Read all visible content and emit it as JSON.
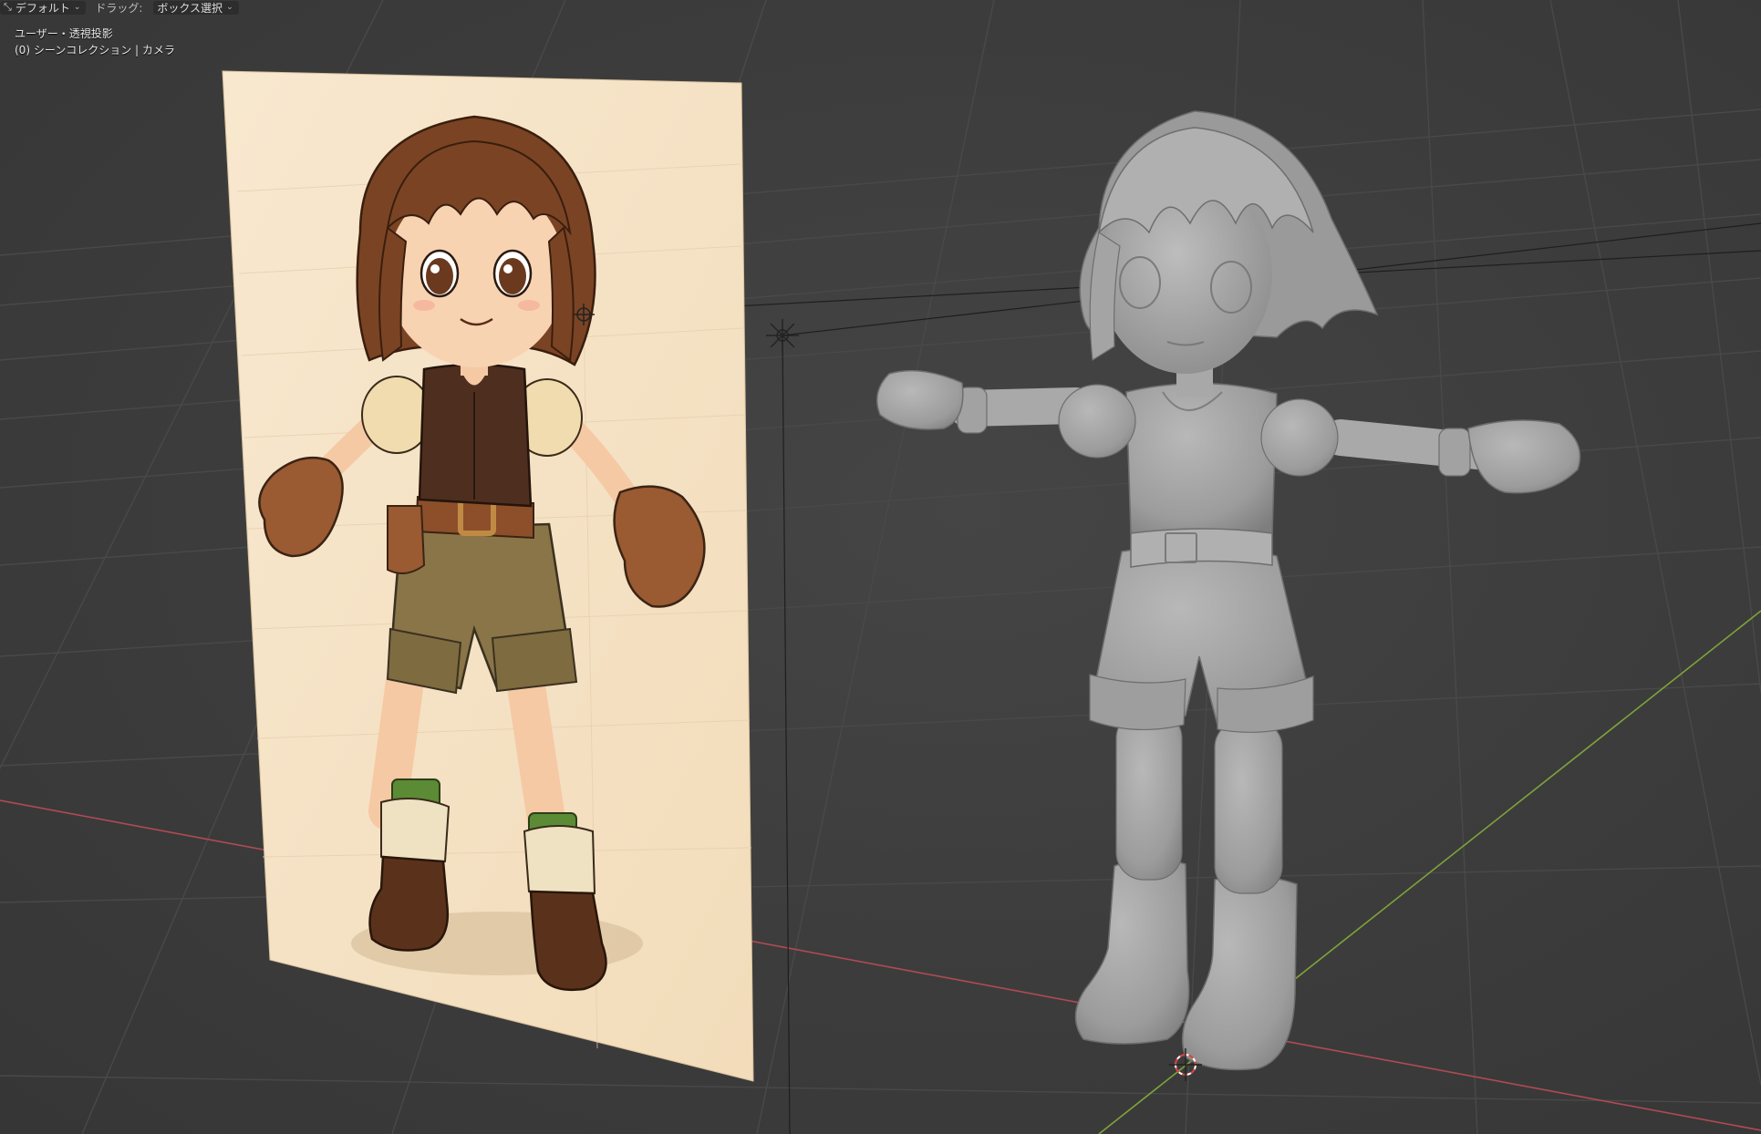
{
  "toolbar": {
    "transform_orientation": "デフォルト",
    "drag_label": "ドラッグ:",
    "drag_mode": "ボックス選択"
  },
  "viewport_overlay": {
    "view_name": "ユーザー・透視投影",
    "collection_info": "(0) シーンコレクション | カメラ"
  },
  "scene": {
    "reference_image": "anime girl reference illustration (brown bob hair, brown vest, khaki shorts, brown mittens and boots)",
    "model": "gray clay-shaded 3D character in T-pose",
    "colors": {
      "background": "#3d3d3d",
      "grid_line": "#4a4a4a",
      "x_axis": "#b04a55",
      "y_axis": "#7fa33a",
      "image_paper": "#f6e3c6",
      "model_clay": "#a4a4a4",
      "hair": "#7a4424",
      "vest": "#4e2f1f",
      "shorts": "#8a7548",
      "mitten": "#9a5a32",
      "sock": "#5b8b35"
    }
  }
}
